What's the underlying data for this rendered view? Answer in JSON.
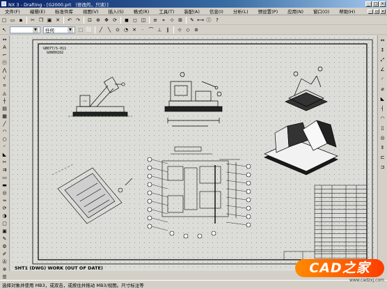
{
  "window": {
    "title": "NX 3 - Drafting - [G2000.prt （修改的，只读）]"
  },
  "menu": {
    "items": [
      "文件(F)",
      "编辑(E)",
      "标准件库",
      "视图(V)",
      "插入(S)",
      "格式(R)",
      "工具(T)",
      "装配(A)",
      "信息(I)",
      "分析(L)",
      "预设置(P)",
      "应用(N)",
      "窗口(O)",
      "帮助(H)"
    ]
  },
  "toolbar": {
    "layer_combo_value": "",
    "filter_combo_value": "任何"
  },
  "drawing": {
    "part_code_line1": "GB077/S-011",
    "part_code_line2": "G0000102"
  },
  "canvas": {
    "sheet_label": "SHT1 (DWG) WORK (OUT OF DATE)"
  },
  "status": {
    "message": "选择对象并使用 MB3，或双击，或按住并拖动 MB3/视图。尺寸标注等"
  },
  "watermark": {
    "logo": "CAD之家",
    "url": "www.cadzxj.com"
  },
  "icons": {
    "left_toolbar": [
      "dimension-icon",
      "note-icon",
      "label-icon",
      "id-symbol-icon",
      "weld-icon",
      "surface-finish-icon",
      "gdt-icon",
      "datum-icon",
      "centerline-icon",
      "hatch-icon",
      "table-icon",
      "line-icon",
      "arc-icon",
      "circle-icon",
      "fillet-icon",
      "chamfer-icon",
      "trim-icon",
      "offset-icon",
      "view-icon",
      "section-icon",
      "detail-icon",
      "break-icon",
      "update-view-icon",
      "display-icon",
      "drawing-icon",
      "sheet-icon",
      "drafting-icon",
      "preferences-icon",
      "edit-icon",
      "annotation-icon",
      "symbol-icon",
      "properties-icon"
    ],
    "right_toolbar": [
      "dim-horizontal-icon",
      "dim-vertical-icon",
      "dim-parallel-icon",
      "dim-angle-icon",
      "dim-radius-icon",
      "dim-diameter-icon",
      "dim-chamfer-icon",
      "dim-ordinate-icon",
      "dim-arc-length-icon",
      "dim-cylindrical-icon",
      "dim-hole-icon",
      "dim-thickness-icon",
      "dim-baseline-icon",
      "dim-chain-icon"
    ]
  }
}
